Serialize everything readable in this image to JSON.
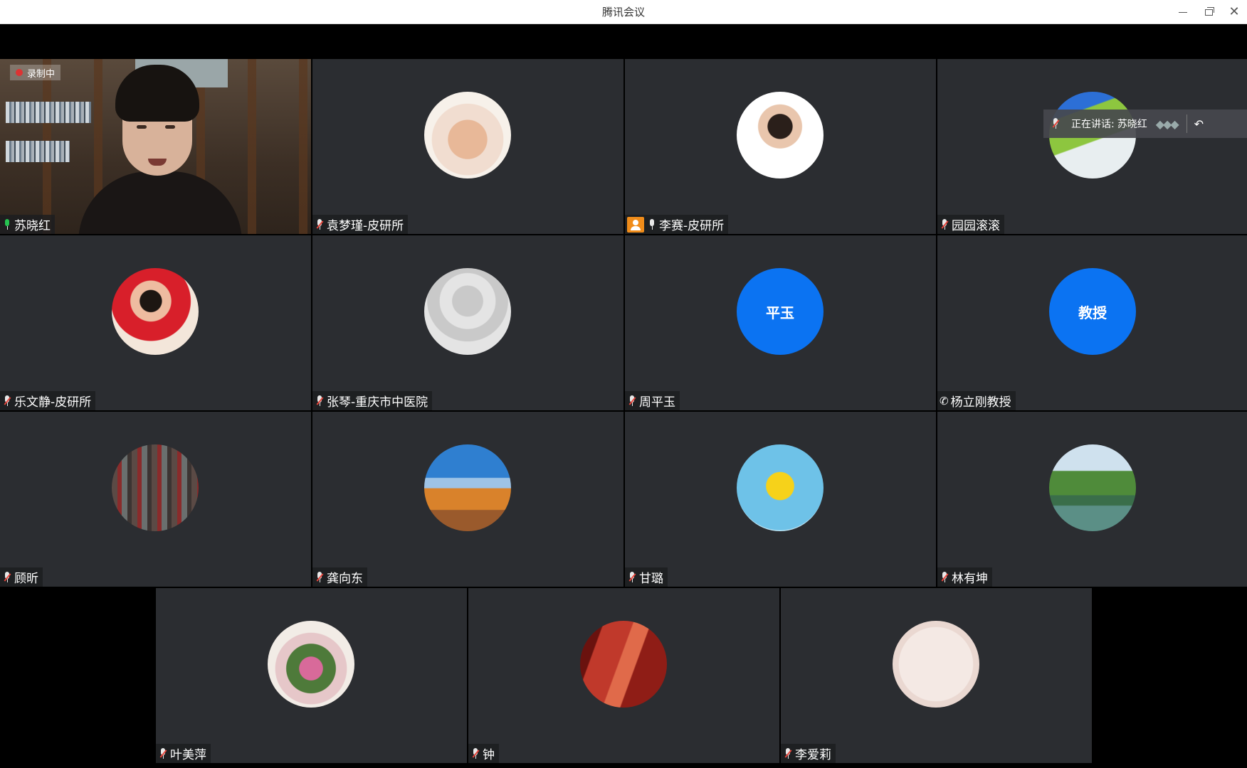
{
  "window": {
    "title": "腾讯会议"
  },
  "speaking_banner": {
    "label": "正在讲话:",
    "name": "苏晓红"
  },
  "speaker_tile": {
    "status_chip": "录制中"
  },
  "participants": [
    {
      "name": "苏晓红",
      "mic": "live",
      "video": true
    },
    {
      "name": "袁梦瑾-皮研所",
      "mic": "muted"
    },
    {
      "name": "李赛-皮研所",
      "mic": "on",
      "host": true
    },
    {
      "name": "园园滚滚",
      "mic": "muted"
    },
    {
      "name": "乐文静-皮研所",
      "mic": "muted"
    },
    {
      "name": "张琴-重庆市中医院",
      "mic": "muted"
    },
    {
      "name": "周平玉",
      "mic": "muted",
      "avatar_text": "平玉"
    },
    {
      "name": "杨立刚教授",
      "mic": "phone",
      "avatar_text": "教授"
    },
    {
      "name": "顾昕",
      "mic": "muted"
    },
    {
      "name": "龚向东",
      "mic": "muted"
    },
    {
      "name": "甘璐",
      "mic": "muted"
    },
    {
      "name": "林有坤",
      "mic": "muted"
    },
    {
      "name": "叶美萍",
      "mic": "muted"
    },
    {
      "name": "钟",
      "mic": "muted"
    },
    {
      "name": "李爱莉",
      "mic": "muted"
    }
  ],
  "colors": {
    "tile_bg": "#2b2d31",
    "avatar_blue": "#0b73f2",
    "active_border": "#1fa340",
    "host_badge": "#f08c1a",
    "mute_red": "#e8463c"
  }
}
